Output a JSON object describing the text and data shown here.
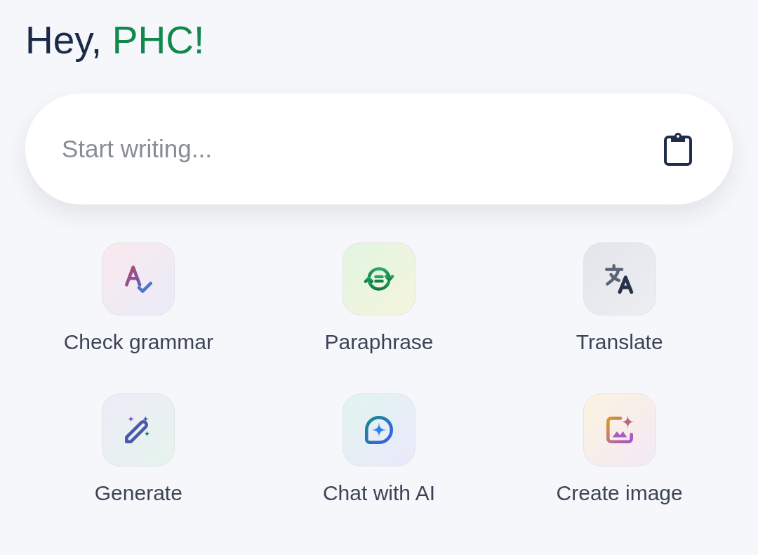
{
  "greeting": {
    "text": "Hey,",
    "name": "PHC!"
  },
  "input": {
    "placeholder": "Start writing..."
  },
  "actions": [
    {
      "label": "Check grammar"
    },
    {
      "label": "Paraphrase"
    },
    {
      "label": "Translate"
    },
    {
      "label": "Generate"
    },
    {
      "label": "Chat with AI"
    },
    {
      "label": "Create image"
    }
  ]
}
